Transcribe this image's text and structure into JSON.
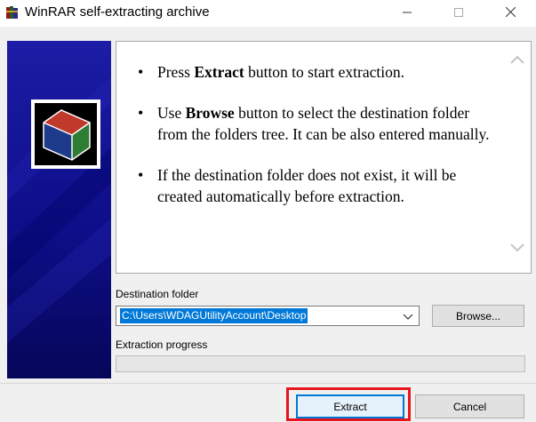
{
  "window": {
    "title": "WinRAR self-extracting archive",
    "icon": "winrar-books-icon",
    "controls": {
      "minimize_icon": "minimize-icon",
      "maximize_icon": "maximize-icon",
      "close_icon": "close-icon"
    }
  },
  "side_panel": {
    "logo_icon": "winrar-box-logo-icon",
    "background_color": "#0e0e8a"
  },
  "info": {
    "bullets": [
      {
        "pre": "Press ",
        "bold": "Extract",
        "post": " button to start extraction."
      },
      {
        "pre": "Use ",
        "bold": "Browse",
        "post": " button to select the destination folder from the folders tree. It can be also entered manually."
      },
      {
        "pre": "",
        "bold": "",
        "post": "If the destination folder does not exist, it will be created automatically before extraction."
      }
    ],
    "scroll_up_icon": "chevron-up-icon",
    "scroll_down_icon": "chevron-down-icon"
  },
  "destination": {
    "label": "Destination folder",
    "value": "C:\\Users\\WDAGUtilityAccount\\Desktop",
    "dropdown_icon": "chevron-down-icon",
    "browse_label": "Browse..."
  },
  "progress": {
    "label": "Extraction progress",
    "value": 0
  },
  "buttons": {
    "extract_label": "Extract",
    "cancel_label": "Cancel"
  },
  "colors": {
    "selection": "#0078d7",
    "highlight": "#e8141b",
    "panel_blue": "#0e0e8a"
  }
}
